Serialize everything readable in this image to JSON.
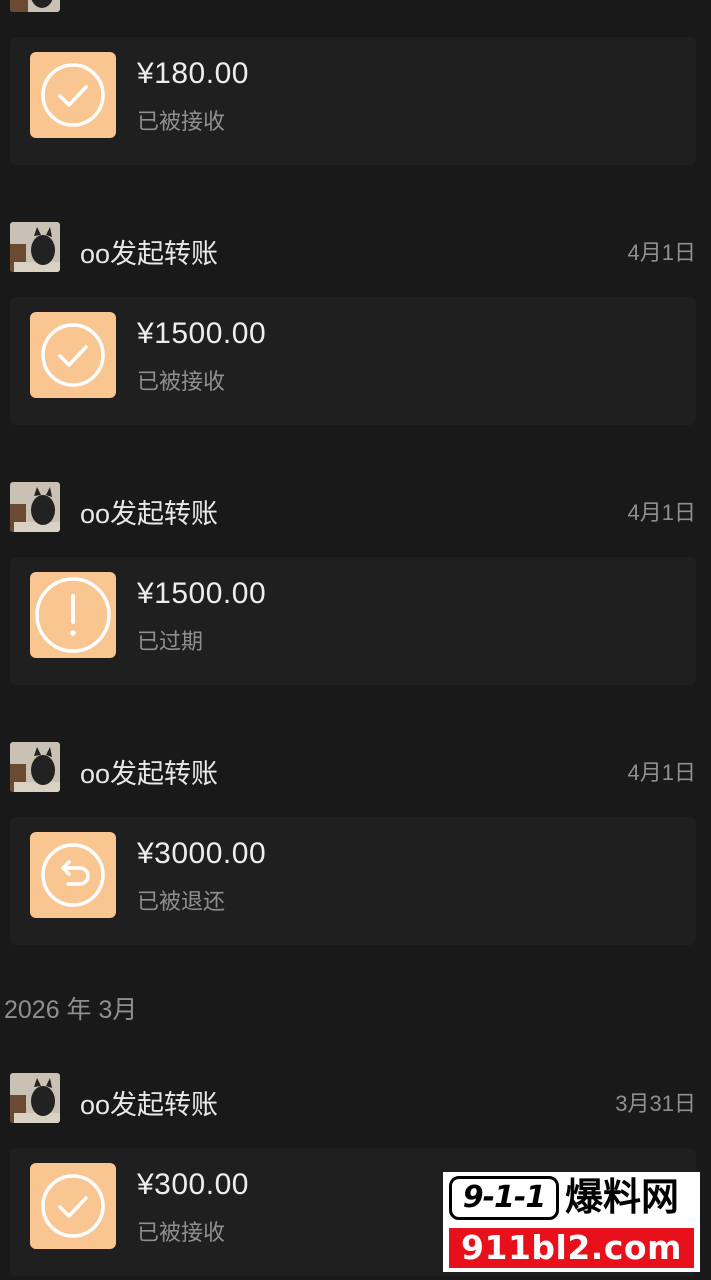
{
  "colors": {
    "background": "#191919",
    "card": "#1f1f1f",
    "icon_bg": "#f9c692",
    "primary_text": "#ededed",
    "secondary_text": "#8f8f8f"
  },
  "transfers": [
    {
      "amount": "¥180.00",
      "status": "已被接收",
      "icon": "check-circle-icon"
    },
    {
      "sender": "oo发起转账",
      "date": "4月1日",
      "amount": "¥1500.00",
      "status": "已被接收",
      "icon": "check-circle-icon"
    },
    {
      "sender": "oo发起转账",
      "date": "4月1日",
      "amount": "¥1500.00",
      "status": "已过期",
      "icon": "exclamation-circle-icon"
    },
    {
      "sender": "oo发起转账",
      "date": "4月1日",
      "amount": "¥3000.00",
      "status": "已被退还",
      "icon": "return-arrow-icon"
    }
  ],
  "month_header": "2026 年 3月",
  "march_transfers": [
    {
      "sender": "oo发起转账",
      "date": "3月31日",
      "amount": "¥300.00",
      "status": "已被接收",
      "icon": "check-circle-icon"
    }
  ],
  "watermark": {
    "badge": "9-1-1",
    "word": "爆料网",
    "url": "911bl2.com"
  }
}
